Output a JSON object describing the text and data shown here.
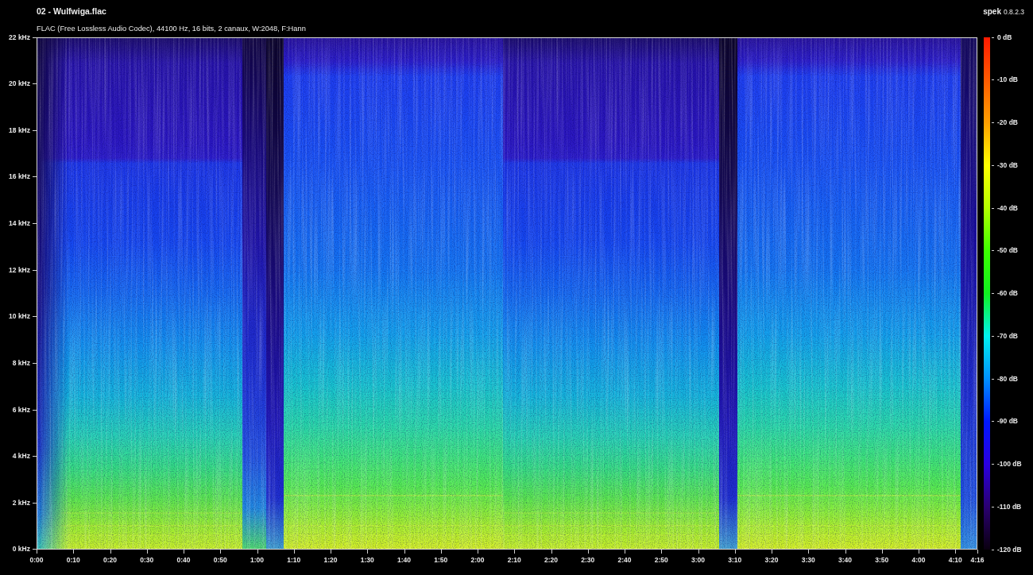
{
  "title": "02 - Wulfwiga.flac",
  "app": {
    "name": "spek",
    "version": "0.8.2.3"
  },
  "file_info": "FLAC (Free Lossless Audio Codec), 44100 Hz, 16 bits, 2 canaux, W:2048, F:Hann",
  "frequency_axis": {
    "ticks": [
      "22 kHz",
      "20 kHz",
      "18 kHz",
      "16 kHz",
      "14 kHz",
      "12 kHz",
      "10 kHz",
      "8 kHz",
      "6 kHz",
      "4 kHz",
      "2 kHz",
      "0 kHz"
    ]
  },
  "time_axis": {
    "ticks": [
      "0:00",
      "0:10",
      "0:20",
      "0:30",
      "0:40",
      "0:50",
      "1:00",
      "1:10",
      "1:20",
      "1:30",
      "1:40",
      "1:50",
      "2:00",
      "2:10",
      "2:20",
      "2:30",
      "2:40",
      "2:50",
      "3:00",
      "3:10",
      "3:20",
      "3:30",
      "3:40",
      "3:50",
      "4:00",
      "4:10",
      "4:16"
    ]
  },
  "color_scale": {
    "ticks": [
      "0 dB",
      "-10 dB",
      "-20 dB",
      "-30 dB",
      "-40 dB",
      "-50 dB",
      "-60 dB",
      "-70 dB",
      "-80 dB",
      "-90 dB",
      "-100 dB",
      "-110 dB",
      "-120 dB"
    ]
  }
}
